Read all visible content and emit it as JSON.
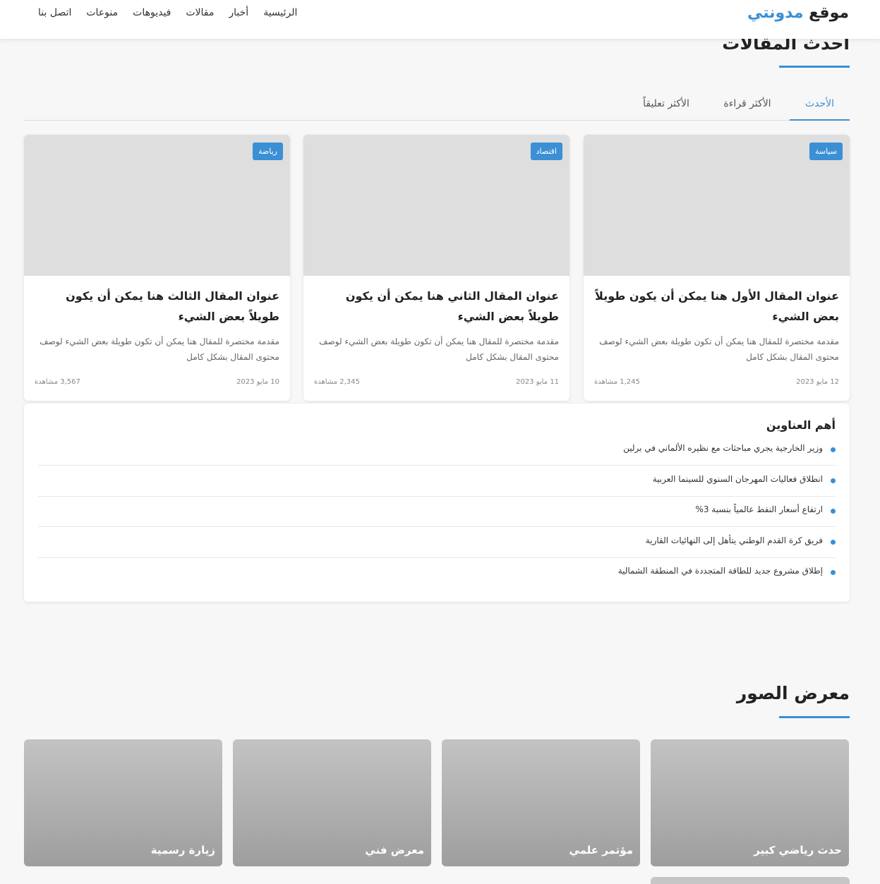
{
  "header": {
    "logo_main": "موقع ",
    "logo_accent": "مدونتي",
    "nav": [
      "الرئيسية",
      "أخبار",
      "مقالات",
      "فيديوهات",
      "منوعات",
      "اتصل بنا"
    ]
  },
  "articles_section": {
    "title": "أحدث المقالات",
    "tabs": [
      "الأحدث",
      "الأكثر قراءة",
      "الأكثر تعليقاً"
    ],
    "active_tab": "الأحدث",
    "cards": [
      {
        "category": "سياسة",
        "title": "عنوان المقال الأول هنا يمكن أن يكون طويلاً بعض الشيء",
        "excerpt": "مقدمة مختصرة للمقال هنا يمكن أن تكون طويلة بعض الشيء لوصف محتوى المقال بشكل كامل",
        "date": "12 مايو 2023",
        "views": "1,245 مشاهدة"
      },
      {
        "category": "اقتصاد",
        "title": "عنوان المقال الثاني هنا يمكن أن يكون طويلاً بعض الشيء",
        "excerpt": "مقدمة مختصرة للمقال هنا يمكن أن تكون طويلة بعض الشيء لوصف محتوى المقال بشكل كامل",
        "date": "11 مايو 2023",
        "views": "2,345 مشاهدة"
      },
      {
        "category": "رياضة",
        "title": "عنوان المقال الثالث هنا يمكن أن يكون طويلاً بعض الشيء",
        "excerpt": "مقدمة مختصرة للمقال هنا يمكن أن تكون طويلة بعض الشيء لوصف محتوى المقال بشكل كامل",
        "date": "10 مايو 2023",
        "views": "3,567 مشاهدة"
      }
    ]
  },
  "headlines": {
    "title": "أهم العناوين",
    "items": [
      "وزير الخارجية يجري مباحثات مع نظيره الألماني في برلين",
      "انطلاق فعاليات المهرجان السنوي للسينما العربية",
      "ارتفاع أسعار النفط عالمياً بنسبة 3%",
      "فريق كرة القدم الوطني يتأهل إلى النهائيات القارية",
      "إطلاق مشروع جديد للطاقة المتجددة في المنطقة الشمالية"
    ]
  },
  "gallery": {
    "title": "معرض الصور",
    "items": [
      "حدث رياضي كبير",
      "مؤتمر علمي",
      "معرض فني",
      "زيارة رسمية"
    ]
  },
  "colors": {
    "accent": "#3a8fd5",
    "background": "#f7f7f7",
    "card_image_placeholder": "#dedede"
  }
}
